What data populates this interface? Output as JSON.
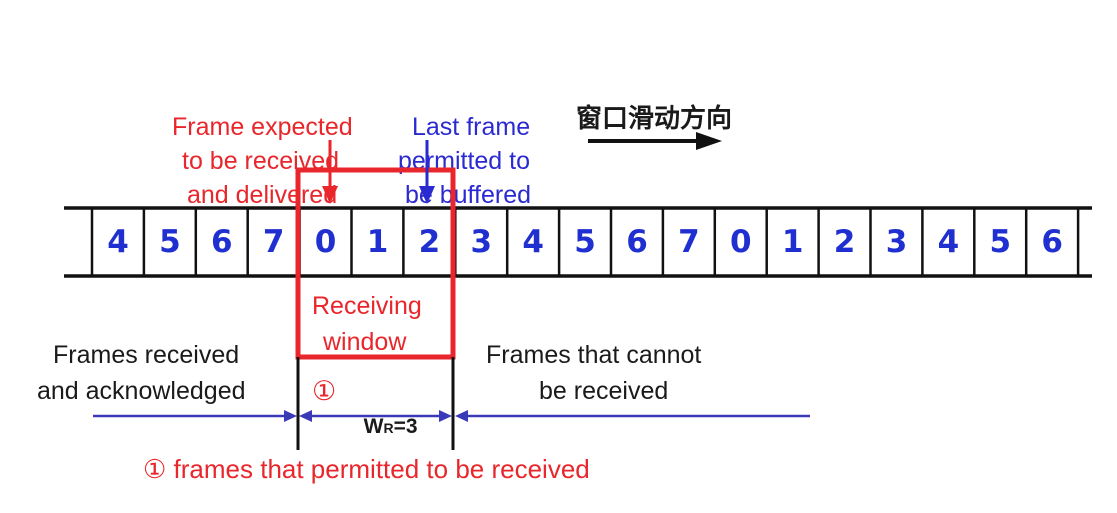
{
  "labels": {
    "expected_line1": "Frame expected",
    "expected_line2": "to be received",
    "expected_line3": "and delivered",
    "last_line1": "Last frame",
    "last_line2": "permitted to",
    "last_line3": "be buffered",
    "direction": "窗口滑动方向",
    "receiving_line1": "Receiving",
    "receiving_line2": "window",
    "received_ack_line1": "Frames received",
    "received_ack_line2": "and acknowledged",
    "cannot_line1": "Frames that cannot",
    "cannot_line2": "be received",
    "window_size_marker": "①",
    "window_size_label": "W",
    "window_size_subscript": "R",
    "window_size_value": "=3",
    "footnote": "① frames that permitted to be received"
  },
  "frames": [
    "4",
    "5",
    "6",
    "7",
    "0",
    "1",
    "2",
    "3",
    "4",
    "5",
    "6",
    "7",
    "0",
    "1",
    "2",
    "3",
    "4",
    "5",
    "6"
  ],
  "colors": {
    "red": "#e8262b",
    "blue": "#2a2ad0",
    "frame_number": "#1f2fd0",
    "lines": "#111111"
  }
}
